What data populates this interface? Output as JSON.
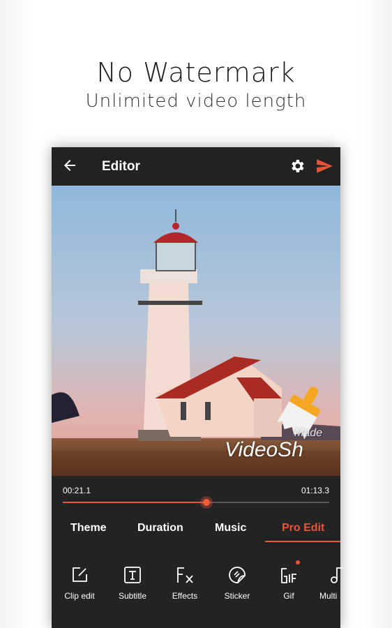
{
  "promo": {
    "headline": "No Watermark",
    "subline": "Unlimited video length"
  },
  "editor": {
    "title": "Editor",
    "icons": {
      "back": "arrow-left-icon",
      "settings": "gear-icon",
      "export": "send-icon"
    },
    "watermark": {
      "made": "Made",
      "brand": "VideoSh",
      "icon": "brush-icon"
    },
    "playback": {
      "current_time": "00:21.1",
      "total_time": "01:13.3",
      "progress": 0.54
    },
    "tabs": [
      {
        "label": "Theme"
      },
      {
        "label": "Duration"
      },
      {
        "label": "Music"
      },
      {
        "label": "Pro Edit",
        "active": true
      }
    ],
    "tools": [
      {
        "label": "Clip edit",
        "icon": "edit-icon"
      },
      {
        "label": "Subtitle",
        "icon": "text-icon"
      },
      {
        "label": "Effects",
        "icon": "fx-icon"
      },
      {
        "label": "Sticker",
        "icon": "sticker-icon"
      },
      {
        "label": "Gif",
        "icon": "gif-icon",
        "badge": true
      },
      {
        "label": "Multi",
        "icon": "music-note-icon"
      }
    ],
    "colors": {
      "accent": "#e8553a",
      "background": "#232323"
    }
  }
}
